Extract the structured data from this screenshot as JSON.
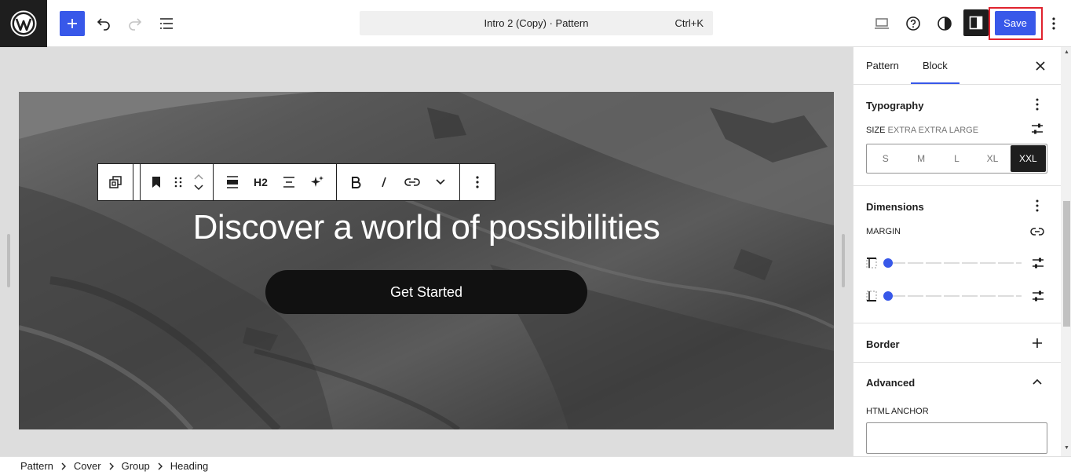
{
  "app": {
    "document_title": "Intro 2 (Copy) · Pattern",
    "command_shortcut": "Ctrl+K",
    "save_label": "Save",
    "accent_color": "#3858e9",
    "highlight_color": "#e0232e"
  },
  "toolbar_icons": [
    "wordpress-logo",
    "plus",
    "undo",
    "redo",
    "list-view",
    "desktop-preview",
    "help",
    "contrast-toggle",
    "settings-sidebar",
    "options-kebab"
  ],
  "canvas": {
    "heading": "Discover a world of possibilities",
    "button_label": "Get Started",
    "block_toolbar": {
      "heading_level": "H2",
      "tools": [
        "transform",
        "bookmark",
        "drag",
        "move-up",
        "move-down",
        "align",
        "heading-level",
        "text-align",
        "ai-sparkle",
        "bold",
        "italic",
        "link",
        "more-rich-text",
        "options"
      ]
    }
  },
  "sidebar": {
    "tabs": [
      {
        "label": "Pattern"
      },
      {
        "label": "Block"
      }
    ],
    "active_tab": "Block",
    "typography": {
      "title": "Typography",
      "size_label": "SIZE",
      "size_value": "EXTRA EXTRA LARGE",
      "size_options": [
        "S",
        "M",
        "L",
        "XL",
        "XXL"
      ],
      "selected_size": "XXL"
    },
    "dimensions": {
      "title": "Dimensions",
      "margin_label": "MARGIN",
      "margin_top": 0,
      "margin_bottom": 0
    },
    "border": {
      "title": "Border"
    },
    "advanced": {
      "title": "Advanced",
      "anchor_label": "HTML ANCHOR",
      "anchor_value": ""
    }
  },
  "breadcrumbs": [
    "Pattern",
    "Cover",
    "Group",
    "Heading"
  ]
}
